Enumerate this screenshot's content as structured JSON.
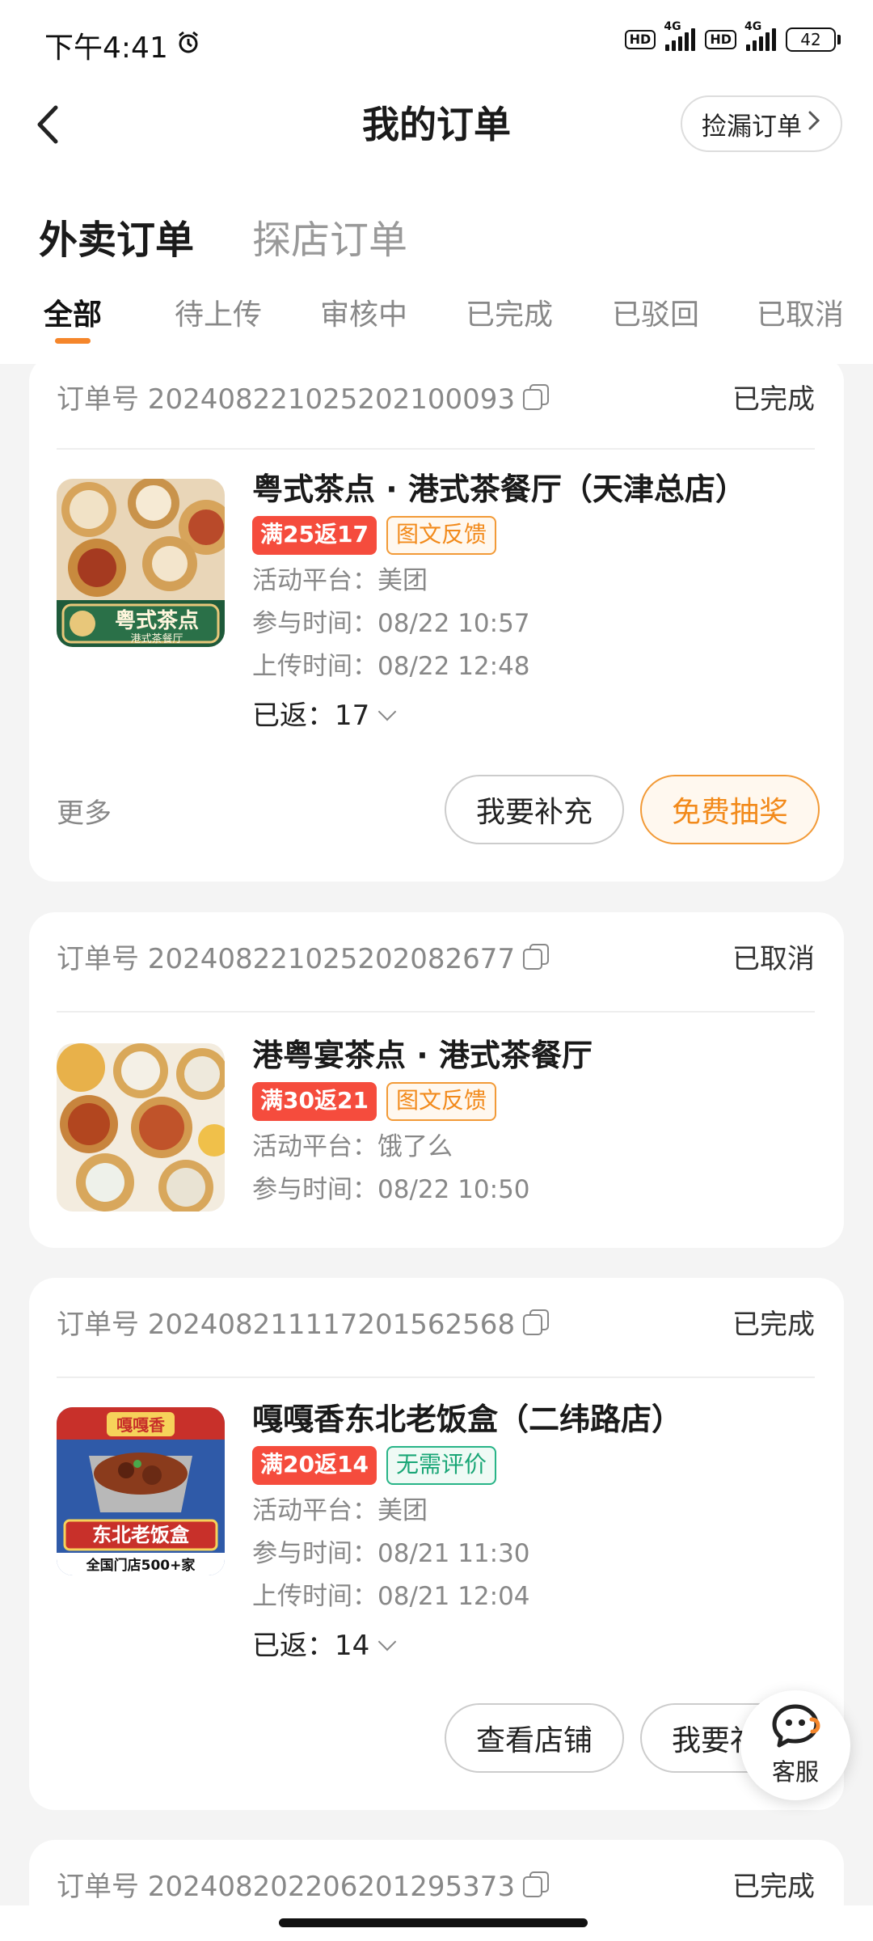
{
  "status_bar": {
    "time": "下午4:41",
    "hd1": "HD",
    "net1": "4G",
    "hd2": "HD",
    "net2": "4G",
    "battery": "42"
  },
  "header": {
    "title": "我的订单",
    "missing_order_label": "捡漏订单"
  },
  "main_tabs": [
    {
      "label": "外卖订单",
      "active": true
    },
    {
      "label": "探店订单",
      "active": false
    }
  ],
  "sub_tabs": [
    {
      "label": "全部",
      "active": true
    },
    {
      "label": "待上传",
      "active": false
    },
    {
      "label": "审核中",
      "active": false
    },
    {
      "label": "已完成",
      "active": false
    },
    {
      "label": "已驳回",
      "active": false
    },
    {
      "label": "已取消",
      "active": false
    }
  ],
  "orders": [
    {
      "order_no": "订单号 20240822102520​2100093",
      "status": "已完成",
      "shop": "粤式茶点 · 港式茶餐厅（天津总店）",
      "tag_rebate": "满25返17",
      "tag_type": "图文反馈",
      "platform": "活动平台：美团",
      "join_time": "参与时间：08/22 10:57",
      "upload_time": "上传时间：08/22 12:48",
      "returned": "已返：17",
      "more": "更多",
      "btn1": "我要补充",
      "btn2": "免费抽奖",
      "thumb_text1": "粤式茶点",
      "thumb_text2": "港式茶餐厅"
    },
    {
      "order_no": "订单号 20240822102520​2082677",
      "status": "已取消",
      "shop": "港粤宴茶点 · 港式茶餐厅",
      "tag_rebate": "满30返21",
      "tag_type": "图文反馈",
      "platform": "活动平台：饿了么",
      "join_time": "参与时间：08/22 10:50"
    },
    {
      "order_no": "订单号 20240821111720​1562568",
      "status": "已完成",
      "shop": "嘎嘎香东北老饭盒（二纬路店）",
      "tag_rebate": "满20返14",
      "tag_type": "无需评价",
      "platform": "活动平台：美团",
      "join_time": "参与时间：08/21 11:30",
      "upload_time": "上传时间：08/21 12:04",
      "returned": "已返：14",
      "btn1": "查看店铺",
      "btn2": "我要补充",
      "thumb_top": "嘎嘎香",
      "thumb_mid": "东北老饭盒",
      "thumb_bottom": "全国门店500+家"
    },
    {
      "order_no": "订单号 20240820220620​1295373",
      "status": "已完成"
    }
  ],
  "customer_service": "客服",
  "colors": {
    "accent": "#f5862b",
    "tag_red": "#f54c3d",
    "tag_orange": "#f28a1b",
    "tag_green": "#19a676"
  }
}
